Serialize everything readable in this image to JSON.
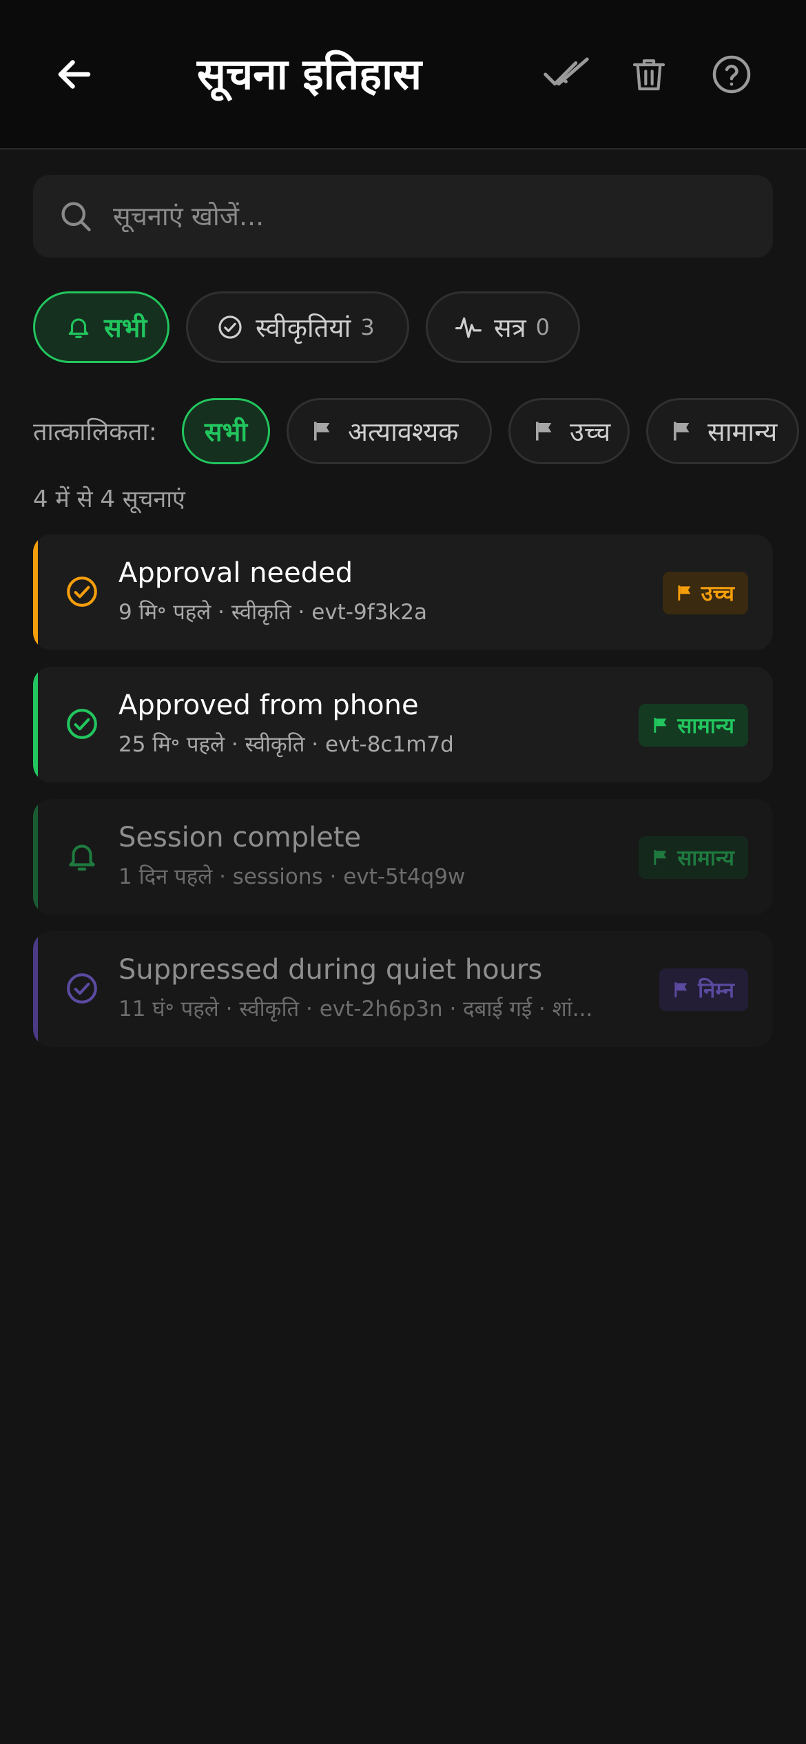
{
  "header": {
    "title": "सूचना इतिहास",
    "back_icon": "arrow-left-icon",
    "actions": [
      "double-check-icon",
      "trash-icon",
      "help-circle-icon"
    ]
  },
  "search": {
    "placeholder": "सूचनाएं खोजें...",
    "value": ""
  },
  "categories": [
    {
      "label": "सभी",
      "icon": "bell-icon",
      "active": true
    },
    {
      "label": "स्वीकृतियां",
      "count": "3",
      "icon": "check-circle-icon",
      "active": false
    },
    {
      "label": "सत्र",
      "count": "0",
      "icon": "activity-icon",
      "active": false
    }
  ],
  "urgency": {
    "label": "तात्कालिकता:",
    "options": [
      {
        "label": "सभी",
        "active": true
      },
      {
        "label": "अत्यावश्यक",
        "icon": "flag-icon",
        "active": false
      },
      {
        "label": "उच्च",
        "icon": "flag-icon",
        "active": false
      },
      {
        "label": "सामान्य",
        "icon": "flag-icon",
        "active": false
      }
    ]
  },
  "summary": "4 में से 4 सूचनाएं",
  "notifications": [
    {
      "title": "Approval needed",
      "meta": "9 मि॰ पहले · स्वीकृति · evt-9f3k2a",
      "badge": "उच्च",
      "status_icon": "check-circle-icon",
      "accent": "#f59e0b",
      "dimmed": false
    },
    {
      "title": "Approved from phone",
      "meta": "25 मि॰ पहले · स्वीकृति · evt-8c1m7d",
      "badge": "सामान्य",
      "status_icon": "check-circle-icon",
      "accent": "#22c55e",
      "dimmed": false
    },
    {
      "title": "Session complete",
      "meta": "1 दिन पहले · sessions · evt-5t4q9w",
      "badge": "सामान्य",
      "status_icon": "bell-icon",
      "accent": "#22c55e",
      "dimmed": true
    },
    {
      "title": "Suppressed during quiet hours",
      "meta": "11 घं॰ पहले · स्वीकृति · evt-2h6p3n · दबाई गई · शां...",
      "badge": "निम्न",
      "status_icon": "check-circle-icon",
      "accent": "#7c5cd6",
      "dimmed": true
    }
  ],
  "colors": {
    "background": "#141414",
    "header": "#0b0b0b",
    "accent_green": "#22c55e",
    "accent_orange": "#f59e0b",
    "accent_purple": "#7c5cd6"
  }
}
